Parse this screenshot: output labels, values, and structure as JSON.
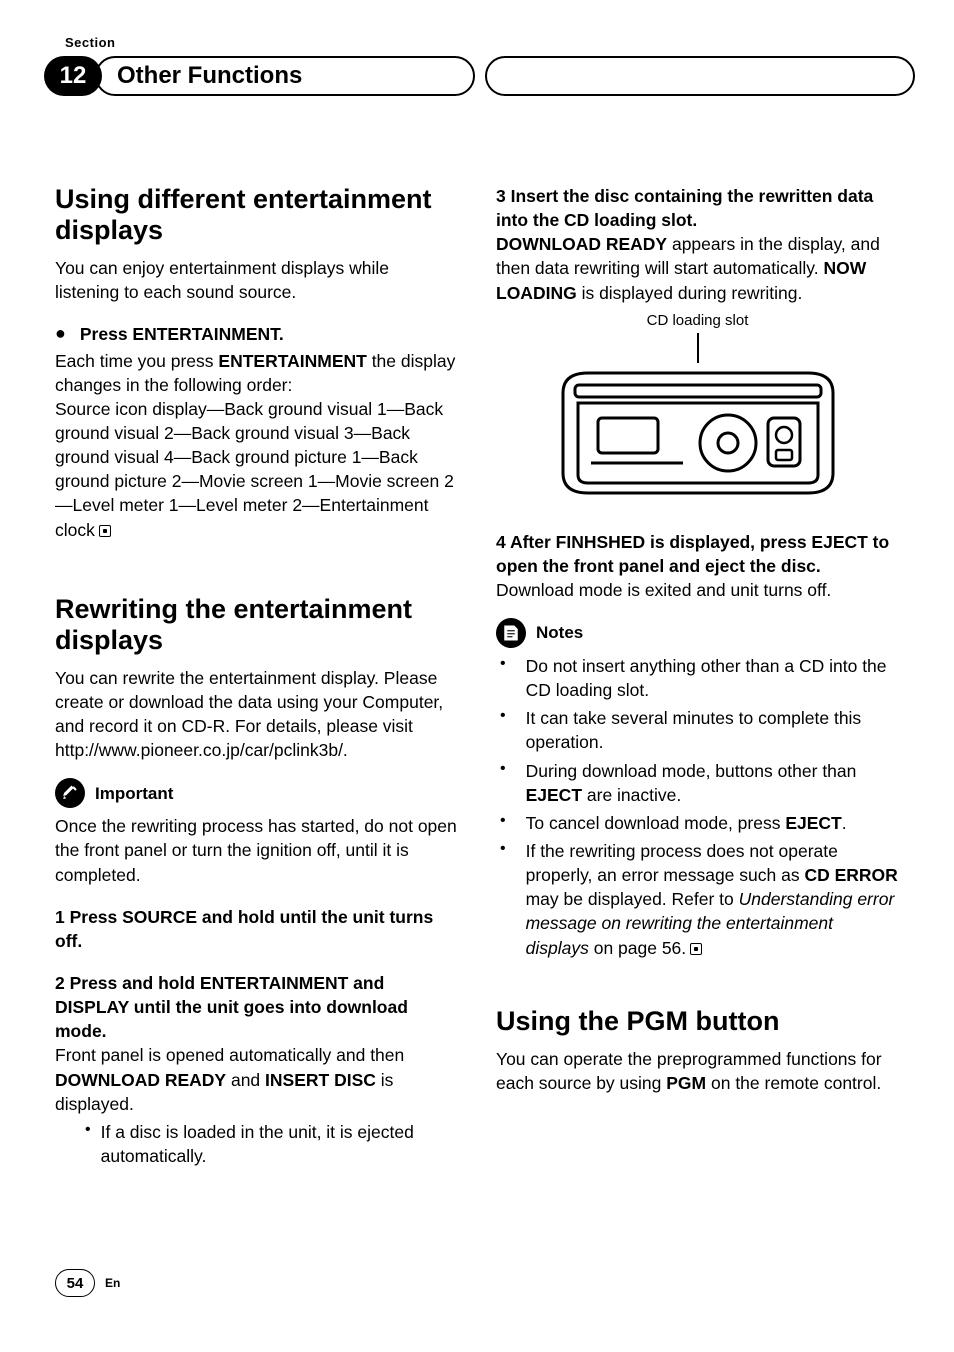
{
  "top_label": "Section",
  "section_number": "12",
  "section_title": "Other Functions",
  "left": {
    "h1": "Using different entertainment displays",
    "intro": "You can enjoy entertainment displays while listening to each sound source.",
    "press_label": "Press ENTERTAINMENT.",
    "each_prefix": "Each time you press ",
    "ent_word": "ENTERTAINMENT",
    "each_suffix": " the display changes in the following order:",
    "order": "Source icon display—Back ground visual 1—Back ground visual 2—Back ground visual 3—Back ground visual 4—Back ground picture 1—Back ground picture 2—Movie screen 1—Movie screen 2—Level meter 1—Level meter 2—Entertainment clock",
    "h2": "Rewriting the entertainment displays",
    "rw_intro": "You can rewrite the entertainment display. Please create or download the data using your Computer, and record it on CD-R. For details, please visit",
    "rw_url": "http://www.pioneer.co.jp/car/pclink3b/.",
    "important_label": "Important",
    "important_text": "Once the rewriting process has started, do not open the front panel or turn the ignition off, until it is completed.",
    "step1_head": "1    Press SOURCE and hold until the unit turns off.",
    "step2_head": "2    Press and hold ENTERTAINMENT and DISPLAY until the unit goes into download mode.",
    "step2_a": "Front panel is opened automatically and then ",
    "step2_b": "DOWNLOAD READY",
    "step2_c": " and ",
    "step2_d": "INSERT DISC",
    "step2_e": " is displayed.",
    "step2_bullet": "If a disc is loaded in the unit, it is ejected automatically."
  },
  "right": {
    "step3_head": "3    Insert the disc containing the rewritten data into the CD loading slot.",
    "step3_a": "DOWNLOAD READY",
    "step3_b": " appears in the display, and then data rewriting will start automatically. ",
    "step3_c": "NOW LOADING",
    "step3_d": " is displayed during rewriting.",
    "fig_caption": "CD loading slot",
    "step4_head": "4    After FINHSHED is displayed, press EJECT to open the front panel and eject the disc.",
    "step4_body": "Download mode is exited and unit turns off.",
    "notes_label": "Notes",
    "note1": "Do not insert anything other than a CD into the CD loading slot.",
    "note2": "It can take several minutes to complete this operation.",
    "note3_a": "During download mode, buttons other than ",
    "note3_b": "EJECT",
    "note3_c": " are inactive.",
    "note4_a": "To cancel download mode, press ",
    "note4_b": "EJECT",
    "note4_c": ".",
    "note5_a": "If the rewriting process does not operate properly, an error message such as ",
    "note5_b": "CD ERROR",
    "note5_c": " may be displayed. Refer to ",
    "note5_d": "Understanding error message on rewriting the entertainment displays",
    "note5_e": " on page 56.",
    "h3": "Using the PGM button",
    "pgm_a": "You can operate the preprogrammed functions for each source by using ",
    "pgm_b": "PGM",
    "pgm_c": " on the remote control."
  },
  "page_number": "54",
  "lang": "En"
}
